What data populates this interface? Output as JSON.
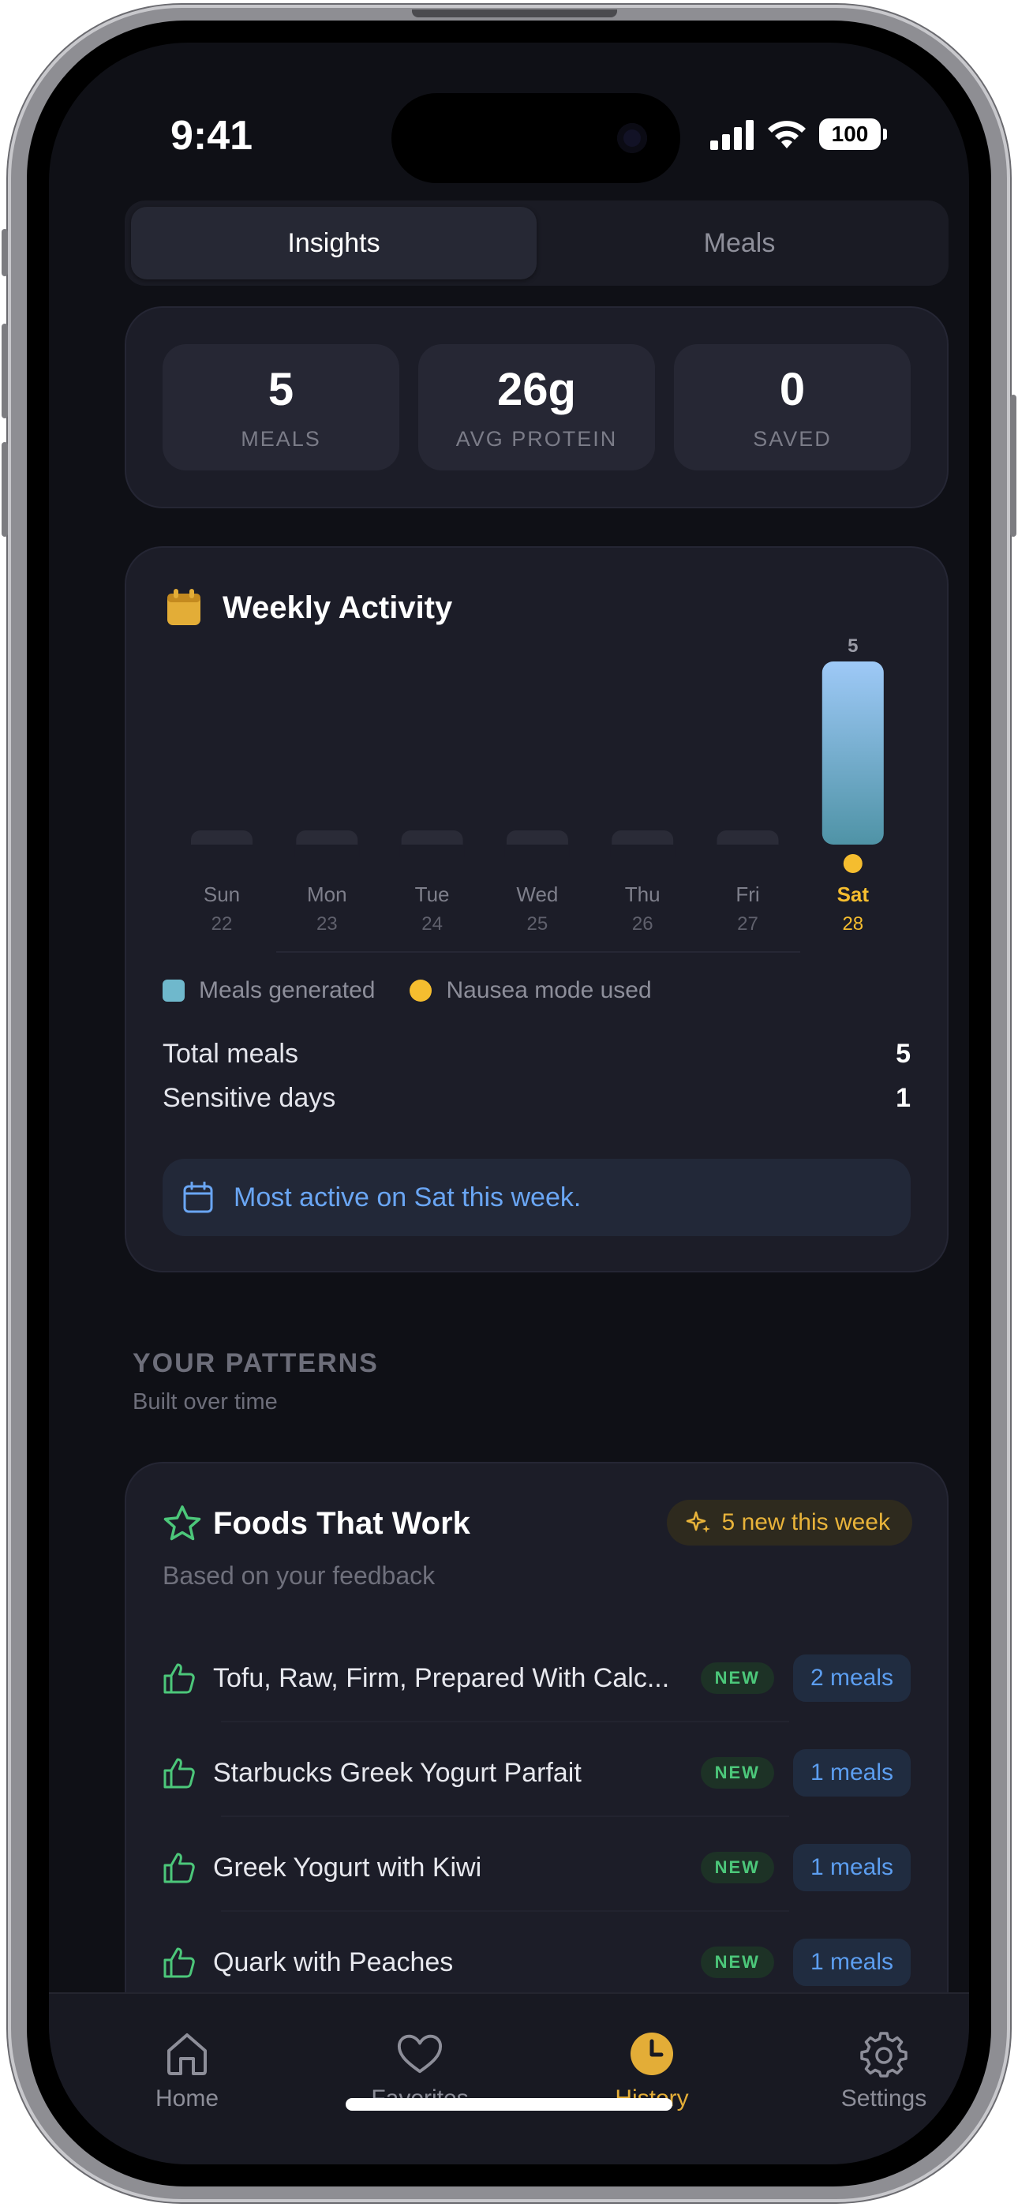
{
  "status_bar": {
    "time": "9:41",
    "battery": "100"
  },
  "segmented": {
    "tabs": [
      "Insights",
      "Meals"
    ],
    "active": 0
  },
  "stats": [
    {
      "value": "5",
      "label": "MEALS"
    },
    {
      "value": "26g",
      "label": "AVG PROTEIN"
    },
    {
      "value": "0",
      "label": "SAVED"
    }
  ],
  "weekly": {
    "title": "Weekly Activity",
    "icon": "calendar-icon",
    "chart_data": {
      "type": "bar",
      "categories": [
        "Sun",
        "Mon",
        "Tue",
        "Wed",
        "Thu",
        "Fri",
        "Sat"
      ],
      "dates": [
        "22",
        "23",
        "24",
        "25",
        "26",
        "27",
        "28"
      ],
      "values": [
        0,
        0,
        0,
        0,
        0,
        0,
        5
      ],
      "nausea_mode": [
        false,
        false,
        false,
        false,
        false,
        false,
        true
      ],
      "highlight_index": 6,
      "ylim": [
        0,
        5
      ],
      "grid": false,
      "legend_placement": "bottom-left",
      "colors": {
        "bar_top": "#9ec9f7",
        "bar_bottom": "#4f93a6",
        "empty_bar": "#2a2b37",
        "nausea_dot": "#f5bd2f",
        "highlight_label": "#f5bd2f"
      }
    },
    "legend": {
      "meals": "Meals generated",
      "nausea": "Nausea mode used"
    },
    "total_label": "Total meals",
    "total_value": "5",
    "sensitive_label": "Sensitive days",
    "sensitive_value": "1",
    "callout": "Most active on Sat this week."
  },
  "patterns": {
    "title": "YOUR PATTERNS",
    "subtitle": "Built over time"
  },
  "foods": {
    "title": "Foods That Work",
    "badge": "5 new this week",
    "subtitle": "Based on your feedback",
    "items": [
      {
        "name": "Tofu, Raw, Firm, Prepared With Calc...",
        "tag": "NEW",
        "meals": "2 meals"
      },
      {
        "name": "Starbucks Greek Yogurt Parfait",
        "tag": "NEW",
        "meals": "1 meals"
      },
      {
        "name": "Greek Yogurt with Kiwi",
        "tag": "NEW",
        "meals": "1 meals"
      },
      {
        "name": "Quark with Peaches",
        "tag": "NEW",
        "meals": "1 meals"
      }
    ]
  },
  "tabbar": {
    "items": [
      {
        "label": "Home",
        "icon": "house-icon"
      },
      {
        "label": "Favorites",
        "icon": "heart-icon"
      },
      {
        "label": "History",
        "icon": "clock-icon"
      },
      {
        "label": "Settings",
        "icon": "gear-icon"
      }
    ],
    "active": 2
  },
  "colors": {
    "accent": "#e3ad37",
    "link": "#6aa6f4",
    "positive": "#4cc77a"
  }
}
